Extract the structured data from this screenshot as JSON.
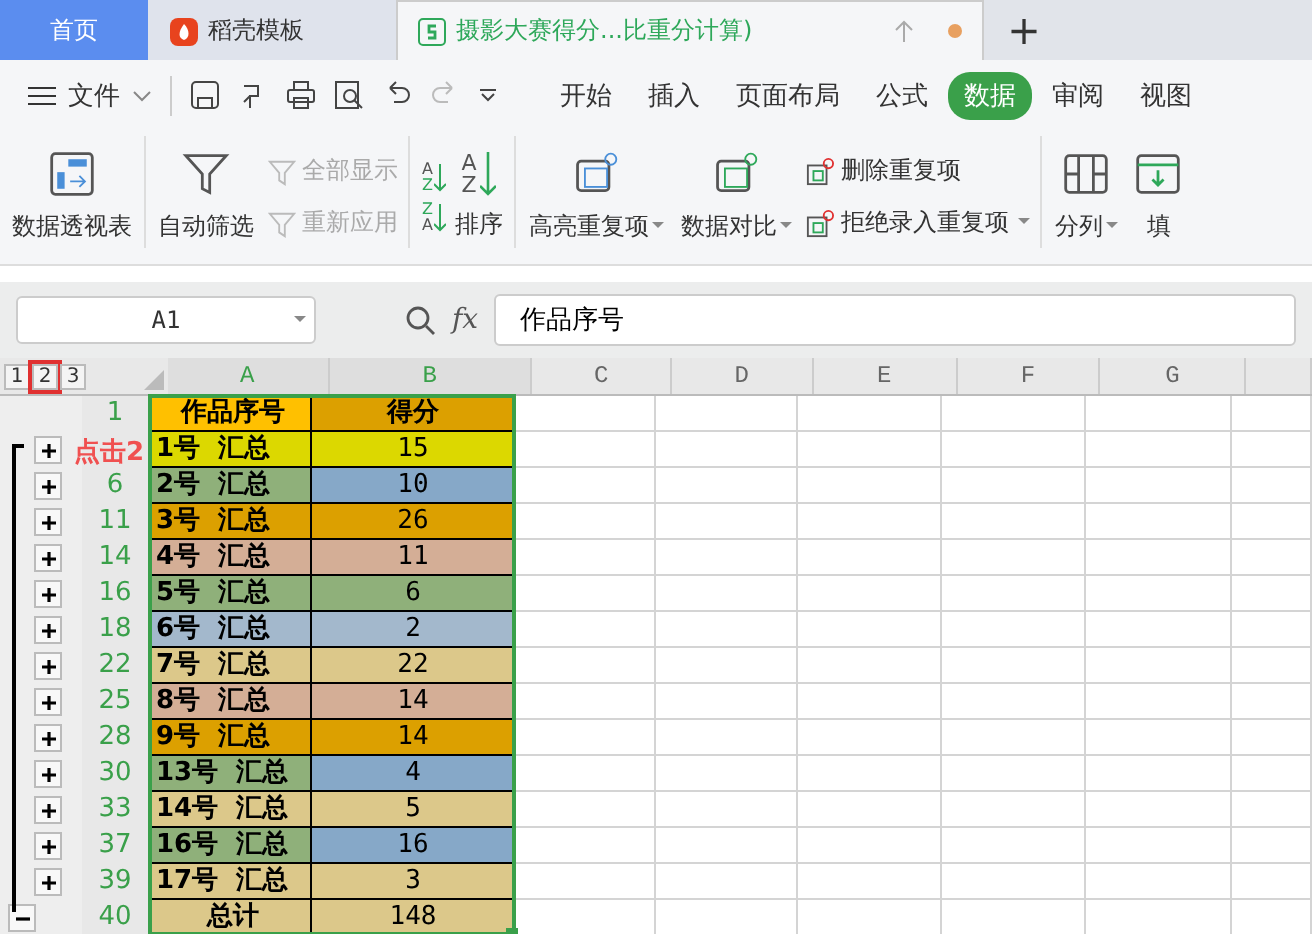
{
  "tabs": [
    {
      "label": "首页",
      "kind": "home",
      "selected": false
    },
    {
      "label": "稻壳模板",
      "kind": "docer",
      "selected": false
    },
    {
      "label": "摄影大赛得分...比重分计算)",
      "kind": "sheet",
      "selected": true
    }
  ],
  "new_tab": "+",
  "menu": {
    "file": "文件",
    "items": [
      {
        "label": "开始",
        "selected": false
      },
      {
        "label": "插入",
        "selected": false
      },
      {
        "label": "页面布局",
        "selected": false
      },
      {
        "label": "公式",
        "selected": false
      },
      {
        "label": "数据",
        "selected": true
      },
      {
        "label": "审阅",
        "selected": false
      },
      {
        "label": "视图",
        "selected": false
      }
    ]
  },
  "ribbon": [
    {
      "kind": "large",
      "label": "数据透视表",
      "dropdown": false
    },
    {
      "kind": "large",
      "label": "自动筛选",
      "dropdown": false
    },
    {
      "kind": "stack",
      "items": [
        {
          "label": "全部显示",
          "disabled": true
        },
        {
          "label": "重新应用",
          "disabled": true
        }
      ]
    },
    {
      "kind": "sort",
      "label": "排序",
      "ascending": [
        "A",
        "Z"
      ],
      "descending": [
        "Z",
        "A"
      ],
      "letters": [
        "A",
        "Z"
      ]
    },
    {
      "kind": "large",
      "label": "高亮重复项",
      "dropdown": true
    },
    {
      "kind": "large",
      "label": "数据对比",
      "dropdown": true
    },
    {
      "kind": "stack",
      "items": [
        {
          "label": "删除重复项",
          "disabled": false
        },
        {
          "label": "拒绝录入重复项",
          "disabled": false
        }
      ]
    },
    {
      "kind": "large",
      "label": "分列",
      "dropdown": true
    },
    {
      "kind": "large",
      "label": "填",
      "dropdown": false
    }
  ],
  "formula_bar": {
    "cell_ref": "A1",
    "fx": "fx",
    "value": "作品序号"
  },
  "outline_levels": [
    {
      "label": "1",
      "annotated": false
    },
    {
      "label": "2",
      "annotated": true
    },
    {
      "label": "3",
      "annotated": false
    }
  ],
  "columns": [
    "A",
    "B",
    "C",
    "D",
    "E",
    "F",
    "G"
  ],
  "annotation": "点击2",
  "rows": [
    {
      "number": "1",
      "kind": "header",
      "cells": [
        {
          "text": "作品序号",
          "color": "#ffc000"
        },
        {
          "text": "得分",
          "color": "#dca000"
        }
      ]
    },
    {
      "number": "",
      "kind": "plus",
      "cells": [
        {
          "text": "1号  汇总",
          "color": "#dcd800"
        },
        {
          "text": "15",
          "color": "#dcd800"
        }
      ]
    },
    {
      "number": "6",
      "kind": "plus",
      "cells": [
        {
          "text": "2号  汇总",
          "color": "#8fb07a"
        },
        {
          "text": "10",
          "color": "#86a8c8"
        }
      ]
    },
    {
      "number": "11",
      "kind": "plus",
      "cells": [
        {
          "text": "3号  汇总",
          "color": "#dca000"
        },
        {
          "text": "26",
          "color": "#dca000"
        }
      ]
    },
    {
      "number": "14",
      "kind": "plus",
      "cells": [
        {
          "text": "4号  汇总",
          "color": "#d4ae96"
        },
        {
          "text": "11",
          "color": "#d4ae96"
        }
      ]
    },
    {
      "number": "16",
      "kind": "plus",
      "cells": [
        {
          "text": "5号  汇总",
          "color": "#8fb07a"
        },
        {
          "text": "6",
          "color": "#8fb07a"
        }
      ]
    },
    {
      "number": "18",
      "kind": "plus",
      "cells": [
        {
          "text": "6号  汇总",
          "color": "#a3b8cc"
        },
        {
          "text": "2",
          "color": "#a3b8cc"
        }
      ]
    },
    {
      "number": "22",
      "kind": "plus",
      "cells": [
        {
          "text": "7号  汇总",
          "color": "#dcc88a"
        },
        {
          "text": "22",
          "color": "#dcc88a"
        }
      ]
    },
    {
      "number": "25",
      "kind": "plus",
      "cells": [
        {
          "text": "8号  汇总",
          "color": "#d4ae96"
        },
        {
          "text": "14",
          "color": "#d4ae96"
        }
      ]
    },
    {
      "number": "28",
      "kind": "plus",
      "cells": [
        {
          "text": "9号  汇总",
          "color": "#dca000"
        },
        {
          "text": "14",
          "color": "#dca000"
        }
      ]
    },
    {
      "number": "30",
      "kind": "plus",
      "cells": [
        {
          "text": "13号  汇总",
          "color": "#8fb07a"
        },
        {
          "text": "4",
          "color": "#86a8c8"
        }
      ]
    },
    {
      "number": "33",
      "kind": "plus",
      "cells": [
        {
          "text": "14号  汇总",
          "color": "#dcc88a"
        },
        {
          "text": "5",
          "color": "#dcc88a"
        }
      ]
    },
    {
      "number": "37",
      "kind": "plus",
      "cells": [
        {
          "text": "16号  汇总",
          "color": "#8fb07a"
        },
        {
          "text": "16",
          "color": "#86a8c8"
        }
      ]
    },
    {
      "number": "39",
      "kind": "plus",
      "cells": [
        {
          "text": "17号  汇总",
          "color": "#dcc88a"
        },
        {
          "text": "3",
          "color": "#dcc88a"
        }
      ]
    },
    {
      "number": "40",
      "kind": "minus",
      "cells": [
        {
          "text": "总计",
          "color": "#dcc88a"
        },
        {
          "text": "148",
          "color": "#dcc88a"
        }
      ]
    }
  ]
}
